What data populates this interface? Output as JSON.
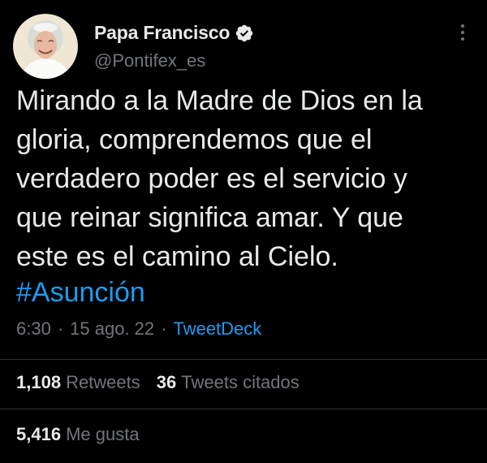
{
  "tweet": {
    "author": {
      "display_name": "Papa Francisco",
      "handle": "@Pontifex_es",
      "verified": true
    },
    "text": "Mirando a la Madre de Dios en la\ngloria, comprendemos que el\nverdadero poder es el servicio y\nque reinar significa amar. Y que\neste es el camino al Cielo.",
    "hashtag": "#Asunción",
    "time": "6:30",
    "date": "15 ago. 22",
    "separator": "·",
    "source": "TweetDeck",
    "stats": {
      "retweets_count": "1,108",
      "retweets_label": "Retweets",
      "quotes_count": "36",
      "quotes_label": "Tweets citados",
      "likes_count": "5,416",
      "likes_label": "Me gusta"
    }
  },
  "colors": {
    "background": "#000000",
    "text": "#e7e9ea",
    "secondary": "#71767b",
    "accent": "#1d9bf0",
    "divider": "#2f3336"
  },
  "icons": {
    "verified": "verified-badge-icon",
    "more": "more-options-icon"
  }
}
